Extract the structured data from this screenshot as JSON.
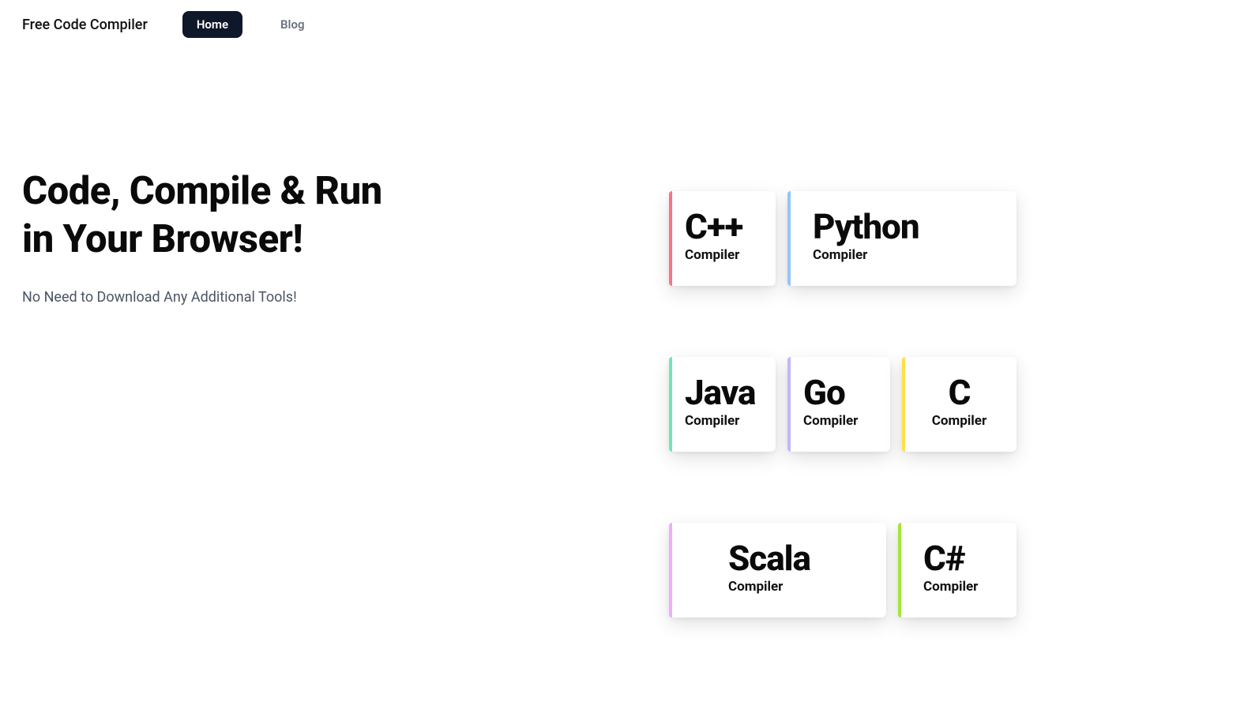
{
  "nav": {
    "brand": "Free Code Compiler",
    "home": "Home",
    "blog": "Blog"
  },
  "hero": {
    "line1": "Code, Compile & Run",
    "line2": "in Your Browser!",
    "sub": "No Need to Download Any Additional Tools!"
  },
  "cards": {
    "cpp": {
      "title": "C++",
      "sub": "Compiler"
    },
    "python": {
      "title": "Python",
      "sub": "Compiler"
    },
    "java": {
      "title": "Java",
      "sub": "Compiler"
    },
    "go": {
      "title": "Go",
      "sub": "Compiler"
    },
    "c": {
      "title": "C",
      "sub": "Compiler"
    },
    "scala": {
      "title": "Scala",
      "sub": "Compiler"
    },
    "csharp": {
      "title": "C#",
      "sub": "Compiler"
    }
  }
}
